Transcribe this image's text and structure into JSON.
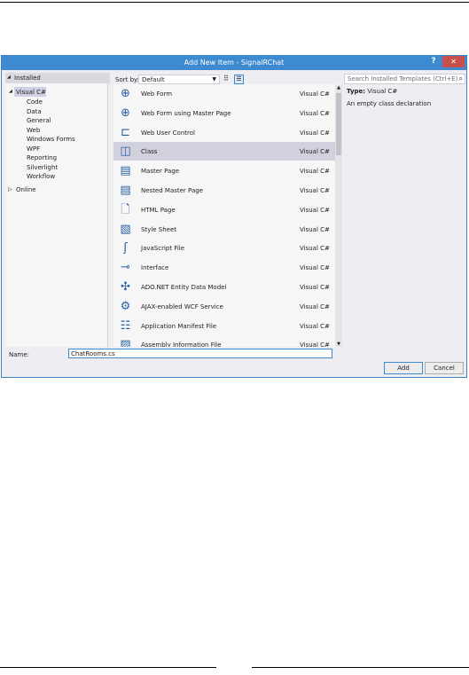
{
  "dialog": {
    "title": "Add New Item - SignalRChat",
    "help": "?",
    "close": "✕"
  },
  "tree": {
    "installed": "Installed",
    "visual_csharp": "Visual C#",
    "children": [
      "Code",
      "Data",
      "General",
      "Web",
      "Windows Forms",
      "WPF",
      "Reporting",
      "Silverlight",
      "Workflow"
    ],
    "online": "Online"
  },
  "toolbar": {
    "sort_label": "Sort by:",
    "sort_value": "Default",
    "search_placeholder": "Search Installed Templates (Ctrl+E)"
  },
  "templates": [
    {
      "name": "Web Form",
      "lang": "Visual C#",
      "icon": "globe-icon"
    },
    {
      "name": "Web Form using Master Page",
      "lang": "Visual C#",
      "icon": "globe-icon"
    },
    {
      "name": "Web User Control",
      "lang": "Visual C#",
      "icon": "user-control-icon"
    },
    {
      "name": "Class",
      "lang": "Visual C#",
      "icon": "class-icon"
    },
    {
      "name": "Master Page",
      "lang": "Visual C#",
      "icon": "master-page-icon"
    },
    {
      "name": "Nested Master Page",
      "lang": "Visual C#",
      "icon": "master-page-icon"
    },
    {
      "name": "HTML Page",
      "lang": "Visual C#",
      "icon": "html-page-icon"
    },
    {
      "name": "Style Sheet",
      "lang": "Visual C#",
      "icon": "style-sheet-icon"
    },
    {
      "name": "JavaScript File",
      "lang": "Visual C#",
      "icon": "javascript-file-icon"
    },
    {
      "name": "Interface",
      "lang": "Visual C#",
      "icon": "interface-icon"
    },
    {
      "name": "ADO.NET Entity Data Model",
      "lang": "Visual C#",
      "icon": "entity-model-icon"
    },
    {
      "name": "AJAX-enabled WCF Service",
      "lang": "Visual C#",
      "icon": "wcf-service-icon"
    },
    {
      "name": "Application Manifest File",
      "lang": "Visual C#",
      "icon": "manifest-icon"
    },
    {
      "name": "Assembly Information File",
      "lang": "Visual C#",
      "icon": "assembly-info-icon"
    }
  ],
  "selected_index": 3,
  "details": {
    "type_label": "Type:",
    "type_value": "Visual C#",
    "description": "An empty class declaration"
  },
  "footer": {
    "name_label": "Name:",
    "name_value": "ChatRooms.cs",
    "add": "Add",
    "cancel": "Cancel"
  }
}
